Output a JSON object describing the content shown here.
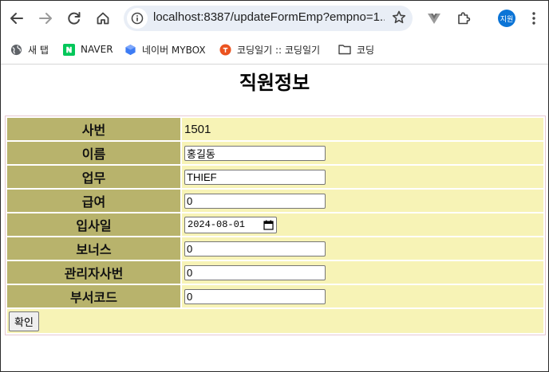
{
  "browser": {
    "url": "localhost:8387/updateFormEmp?empno=1...",
    "profile_initials": "지원",
    "bookmarks": [
      {
        "label": "새 탭",
        "icon": "globe-icon"
      },
      {
        "label": "NAVER",
        "icon": "naver-logo-icon"
      },
      {
        "label": "네이버 MYBOX",
        "icon": "mybox-icon"
      },
      {
        "label": "코딩일기 :: 코딩일기",
        "icon": "blog-icon"
      },
      {
        "label": "코딩",
        "icon": "folder-icon"
      }
    ]
  },
  "page": {
    "title": "직원정보",
    "fields": [
      {
        "label": "사번",
        "value": "1501",
        "type": "readonly"
      },
      {
        "label": "이름",
        "value": "홍길동",
        "type": "text"
      },
      {
        "label": "업무",
        "value": "THIEF",
        "type": "text"
      },
      {
        "label": "급여",
        "value": "0",
        "type": "text"
      },
      {
        "label": "입사일",
        "value": "2024-08-01",
        "type": "date"
      },
      {
        "label": "보너스",
        "value": "0",
        "type": "text"
      },
      {
        "label": "관리자사번",
        "value": "0",
        "type": "text"
      },
      {
        "label": "부서코드",
        "value": "0",
        "type": "text"
      }
    ],
    "submit_label": "확인"
  },
  "colors": {
    "label_bg": "#b8b36c",
    "value_bg": "#f7f3b6",
    "accent": "#0b74d6"
  }
}
